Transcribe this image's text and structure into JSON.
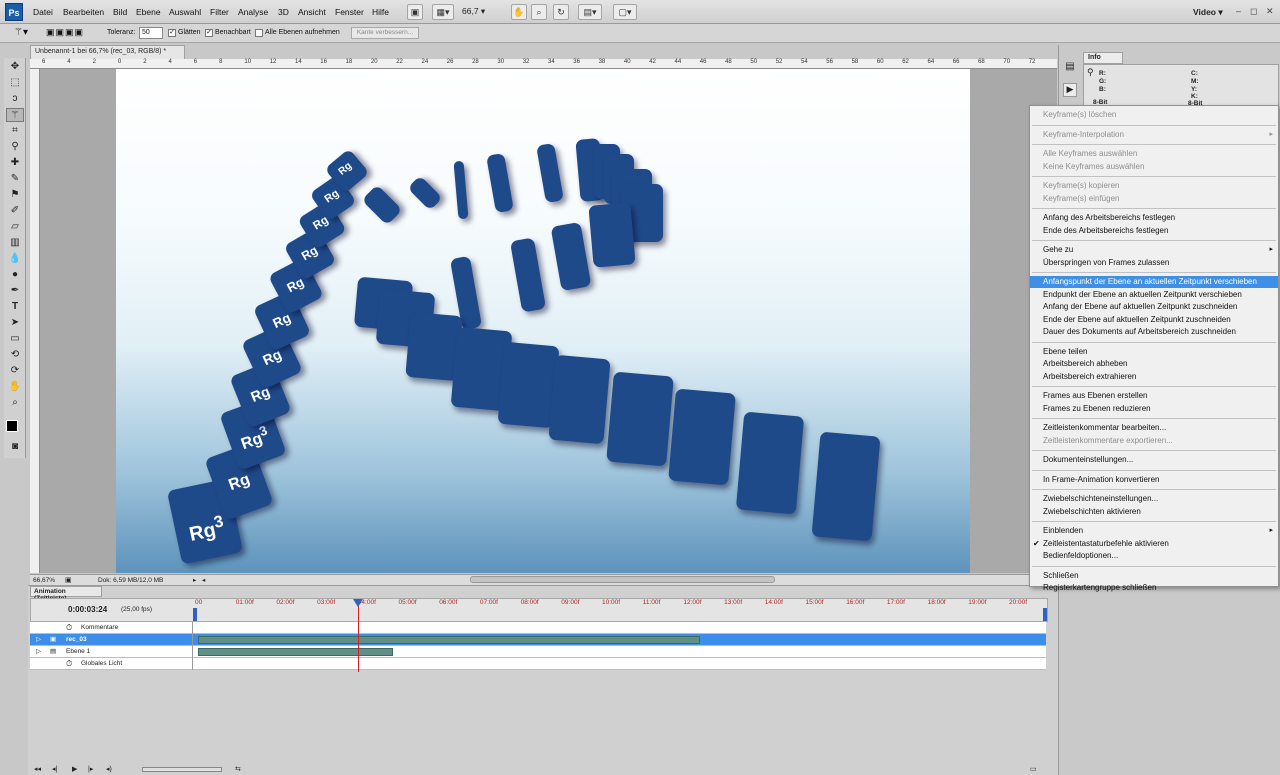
{
  "app": {
    "logo": "Ps",
    "menus": [
      "Datei",
      "Bearbeiten",
      "Bild",
      "Ebene",
      "Auswahl",
      "Filter",
      "Analyse",
      "3D",
      "Ansicht",
      "Fenster",
      "Hilfe"
    ],
    "zoom": "66,7",
    "workspace": "Video"
  },
  "options": {
    "tolerance_label": "Toleranz:",
    "tolerance_value": "50",
    "smooth_label": "Glätten",
    "contiguous_label": "Benachbart",
    "all_layers_label": "Alle Ebenen aufnehmen",
    "refine_button": "Kante verbessern..."
  },
  "document": {
    "tab_title": "Unbenannt-1 bei 66,7% (rec_03, RGB/8) *",
    "ruler_ticks": [
      "6",
      "4",
      "2",
      "0",
      "2",
      "4",
      "6",
      "8",
      "10",
      "12",
      "14",
      "16",
      "18",
      "20",
      "22",
      "24",
      "26",
      "28",
      "30",
      "32",
      "34",
      "36",
      "38",
      "40",
      "42",
      "44",
      "46",
      "48",
      "50",
      "52",
      "54",
      "56",
      "58",
      "60",
      "62",
      "64",
      "66",
      "68",
      "70",
      "72"
    ],
    "status_zoom": "66,67%",
    "status_doc": "Dok: 6,59 MB/12,0 MB"
  },
  "image": {
    "tile_text": "Rg",
    "tile_exponent": "3"
  },
  "info_panel": {
    "tab": "Info",
    "left_labels": [
      "R:",
      "G:",
      "B:"
    ],
    "left_bits": "8-Bit",
    "right_labels": [
      "C:",
      "M:",
      "Y:",
      "K:"
    ],
    "right_bits": "8-Bit"
  },
  "context_menu": {
    "items": [
      {
        "label": "Keyframe(s) löschen",
        "state": "disabled"
      },
      {
        "separator": true
      },
      {
        "label": "Keyframe-Interpolation",
        "state": "disabled",
        "submenu": true
      },
      {
        "separator": true
      },
      {
        "label": "Alle Keyframes auswählen",
        "state": "disabled"
      },
      {
        "label": "Keine Keyframes auswählen",
        "state": "disabled"
      },
      {
        "separator": true
      },
      {
        "label": "Keyframe(s) kopieren",
        "state": "disabled"
      },
      {
        "label": "Keyframe(s) einfügen",
        "state": "disabled"
      },
      {
        "separator": true
      },
      {
        "label": "Anfang des Arbeitsbereichs festlegen",
        "state": "enabled"
      },
      {
        "label": "Ende des Arbeitsbereichs festlegen",
        "state": "enabled"
      },
      {
        "separator": true
      },
      {
        "label": "Gehe zu",
        "state": "enabled",
        "submenu": true
      },
      {
        "label": "Überspringen von Frames zulassen",
        "state": "enabled"
      },
      {
        "separator": true
      },
      {
        "label": "Anfangspunkt der Ebene an aktuellen Zeitpunkt verschieben",
        "state": "highlighted"
      },
      {
        "label": "Endpunkt der Ebene an aktuellen Zeitpunkt verschieben",
        "state": "enabled"
      },
      {
        "label": "Anfang der Ebene auf aktuellen Zeitpunkt zuschneiden",
        "state": "enabled"
      },
      {
        "label": "Ende der Ebene auf aktuellen Zeitpunkt zuschneiden",
        "state": "enabled"
      },
      {
        "label": "Dauer des Dokuments auf Arbeitsbereich zuschneiden",
        "state": "enabled"
      },
      {
        "separator": true
      },
      {
        "label": "Ebene teilen",
        "state": "enabled"
      },
      {
        "label": "Arbeitsbereich abheben",
        "state": "enabled"
      },
      {
        "label": "Arbeitsbereich extrahieren",
        "state": "enabled"
      },
      {
        "separator": true
      },
      {
        "label": "Frames aus Ebenen erstellen",
        "state": "enabled"
      },
      {
        "label": "Frames zu Ebenen reduzieren",
        "state": "enabled"
      },
      {
        "separator": true
      },
      {
        "label": "Zeitleistenkommentar bearbeiten...",
        "state": "enabled"
      },
      {
        "label": "Zeitleistenkommentare exportieren...",
        "state": "disabled"
      },
      {
        "separator": true
      },
      {
        "label": "Dokumenteinstellungen...",
        "state": "enabled"
      },
      {
        "separator": true
      },
      {
        "label": "In Frame-Animation konvertieren",
        "state": "enabled"
      },
      {
        "separator": true
      },
      {
        "label": "Zwiebelschichteneinstellungen...",
        "state": "enabled"
      },
      {
        "label": "Zwiebelschichten aktivieren",
        "state": "enabled"
      },
      {
        "separator": true
      },
      {
        "label": "Einblenden",
        "state": "enabled",
        "submenu": true
      },
      {
        "label": "Zeitleistentastaturbefehle aktivieren",
        "state": "enabled",
        "checked": true
      },
      {
        "label": "Bedienfeldoptionen...",
        "state": "enabled"
      },
      {
        "separator": true
      },
      {
        "label": "Schließen",
        "state": "enabled"
      },
      {
        "label": "Registerkartengruppe schließen",
        "state": "enabled"
      }
    ]
  },
  "timeline": {
    "tab": "Animation (Zeitleiste)",
    "timecode": "0:00:03:24",
    "fps": "(25,00 fps)",
    "ticks": [
      "00",
      "01:00f",
      "02:00f",
      "03:00f",
      "04:00f",
      "05:00f",
      "06:00f",
      "07:00f",
      "08:00f",
      "09:00f",
      "10:00f",
      "11:00f",
      "12:00f",
      "13:00f",
      "14:00f",
      "15:00f",
      "16:00f",
      "17:00f",
      "18:00f",
      "19:00f",
      "20:00f"
    ],
    "layers": [
      {
        "name": "Kommentare"
      },
      {
        "name": "rec_03"
      },
      {
        "name": "Ebene 1"
      },
      {
        "name": "Globales Licht"
      }
    ]
  },
  "colors": {
    "selection": "#3d8ee8",
    "menu_highlight": "#3f8fe6",
    "tile_blue": "#1f4a8a",
    "playhead": "#d21f1f",
    "layer_bar": "#5f8f86"
  }
}
